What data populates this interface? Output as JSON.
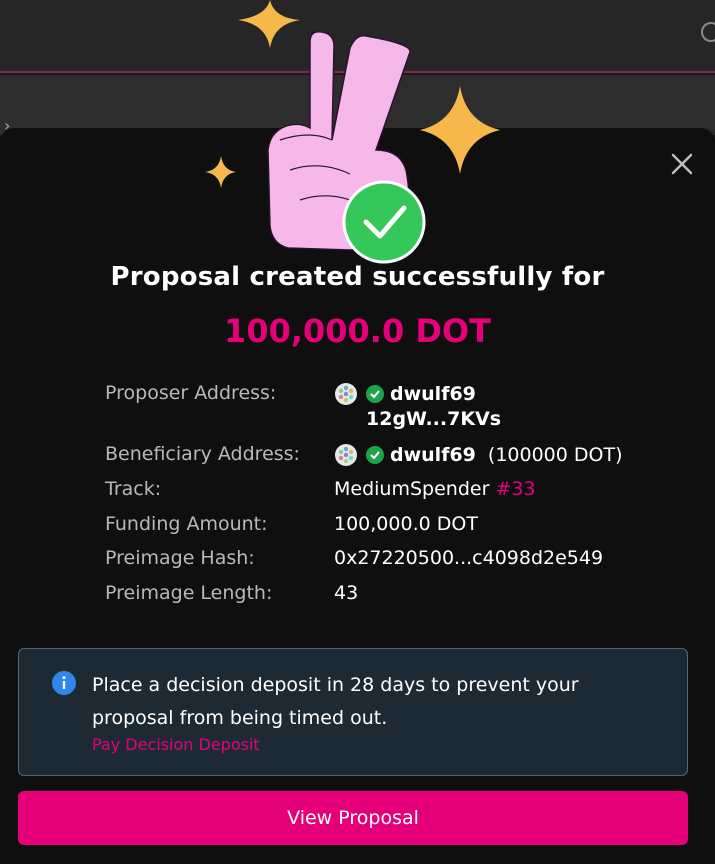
{
  "modal": {
    "heading": "Proposal created successfully for",
    "amount": "100,000.0 DOT"
  },
  "details": {
    "proposer_label": "Proposer Address:",
    "proposer_name": "dwulf69",
    "proposer_address": "12gW...7KVs",
    "beneficiary_label": "Beneficiary Address:",
    "beneficiary_name": "dwulf69",
    "beneficiary_amount": "(100000 DOT)",
    "track_label": "Track:",
    "track_name": "MediumSpender",
    "track_number": "#33",
    "funding_label": "Funding Amount:",
    "funding_value": "100,000.0 DOT",
    "hash_label": "Preimage Hash:",
    "hash_value": "0x27220500...c4098d2e549",
    "length_label": "Preimage Length:",
    "length_value": "43"
  },
  "alert": {
    "message": "Place a decision deposit in 28 days to prevent your proposal from being timed out.",
    "link": "Pay Decision Deposit"
  },
  "actions": {
    "view_proposal": "View Proposal"
  },
  "colors": {
    "accent": "#e5007a",
    "success": "#2ed47a",
    "modal_bg": "#0f0f0f",
    "alert_bg": "#1e2a33"
  },
  "icons": {
    "close": "close-icon",
    "info": "info-icon",
    "verified": "verified-check-icon",
    "success": "success-check-icon"
  }
}
